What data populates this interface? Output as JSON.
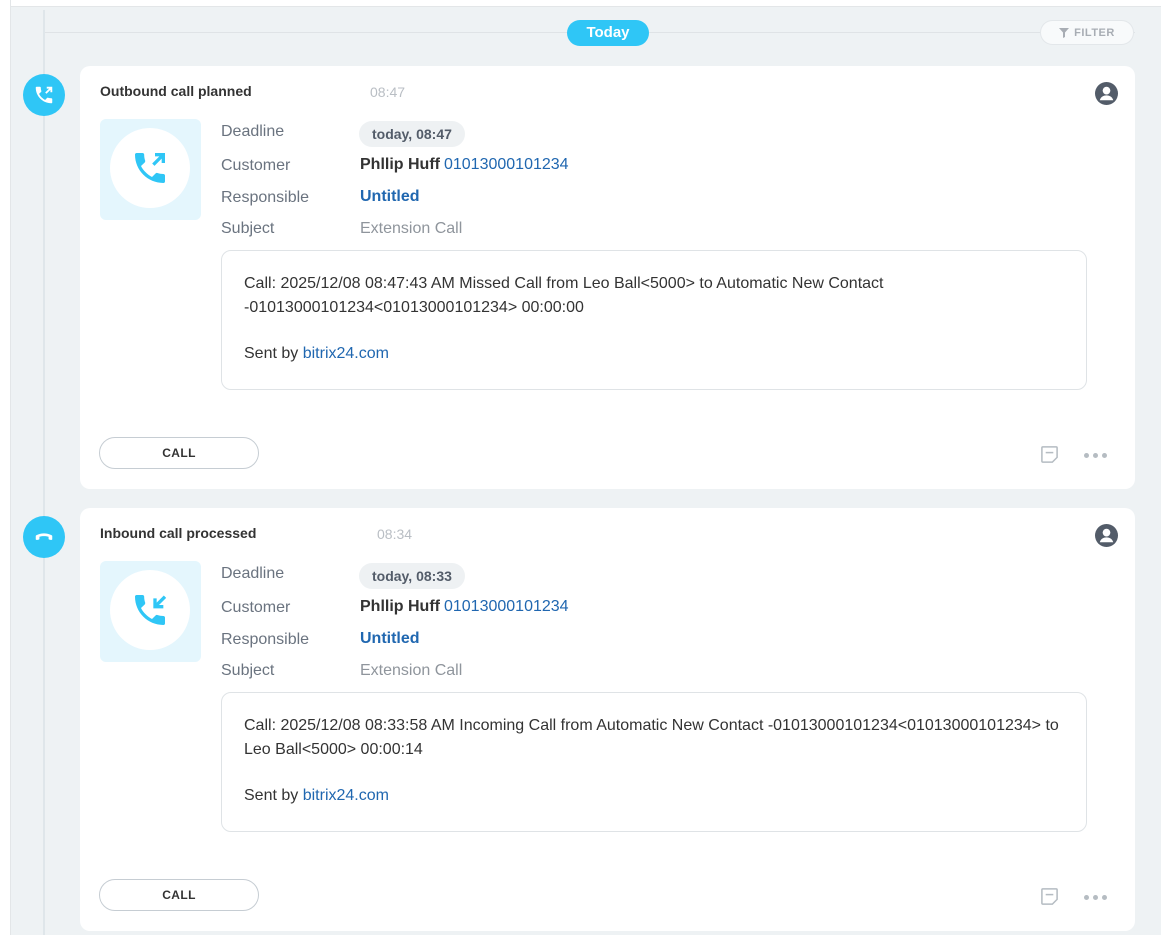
{
  "header": {
    "day_label": "Today",
    "filter_label": "FILTER"
  },
  "activities": [
    {
      "title": "Outbound call planned",
      "time": "08:47",
      "deadline_label": "Deadline",
      "deadline_value": "today, 08:47",
      "customer_label": "Customer",
      "customer_name": "Phllip Huff",
      "customer_phone": "01013000101234",
      "responsible_label": "Responsible",
      "responsible_value": "Untitled",
      "subject_label": "Subject",
      "subject_value": "Extension Call",
      "description": "Call: 2025/12/08 08:47:43 AM Missed Call from Leo Ball<5000> to Automatic New Contact -01013000101234<01013000101234> 00:00:00",
      "sent_by_prefix": "Sent by",
      "sent_by_link": "bitrix24.com",
      "call_button": "CALL",
      "direction": "outbound"
    },
    {
      "title": "Inbound call processed",
      "time": "08:34",
      "deadline_label": "Deadline",
      "deadline_value": "today, 08:33",
      "customer_label": "Customer",
      "customer_name": "Phllip Huff",
      "customer_phone": "01013000101234",
      "responsible_label": "Responsible",
      "responsible_value": "Untitled",
      "subject_label": "Subject",
      "subject_value": "Extension Call",
      "description": "Call: 2025/12/08 08:33:58 AM Incoming Call from Automatic New Contact -01013000101234<01013000101234> to Leo Ball<5000> 00:00:14",
      "sent_by_prefix": "Sent by",
      "sent_by_link": "bitrix24.com",
      "call_button": "CALL",
      "direction": "inbound"
    }
  ],
  "colors": {
    "accent": "#2fc6f6",
    "link": "#2067b0",
    "background": "#eef2f4"
  },
  "icons": [
    "outbound-call-icon",
    "hangup-call-icon",
    "user-icon",
    "note-icon",
    "more-icon",
    "filter-icon"
  ]
}
